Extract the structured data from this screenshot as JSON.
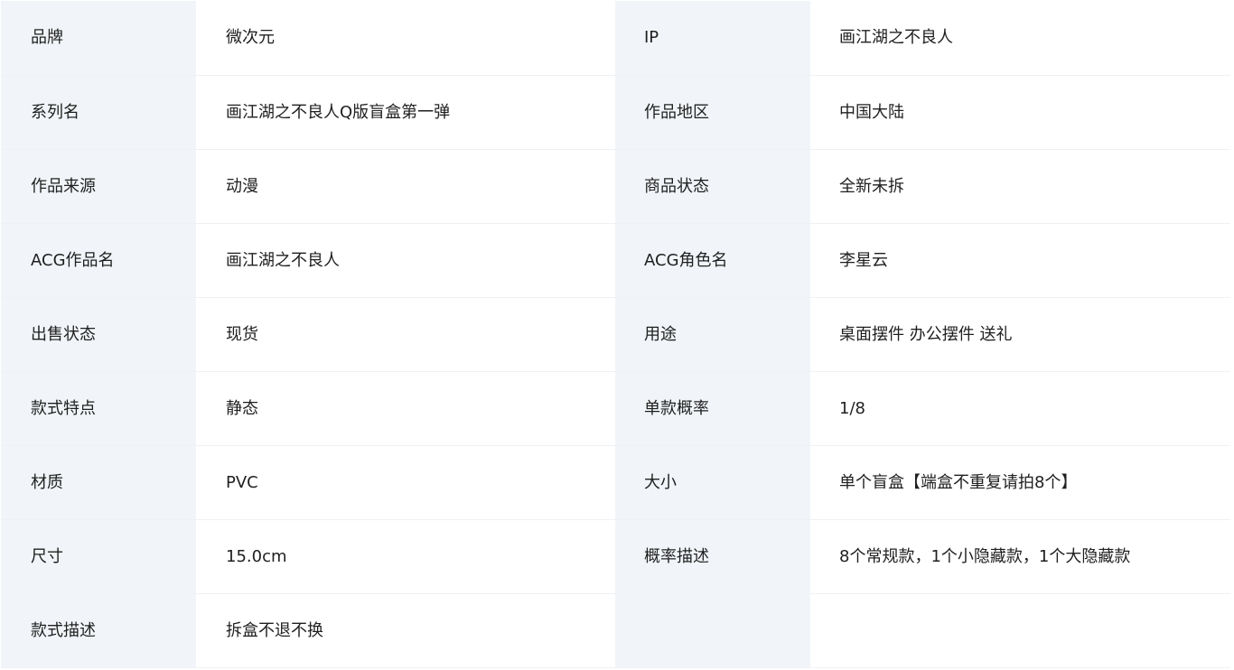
{
  "rows": [
    {
      "left": {
        "label": "品牌",
        "value": "微次元"
      },
      "right": {
        "label": "IP",
        "value": "画江湖之不良人"
      }
    },
    {
      "left": {
        "label": "系列名",
        "value": "画江湖之不良人Q版盲盒第一弹"
      },
      "right": {
        "label": "作品地区",
        "value": "中国大陆"
      }
    },
    {
      "left": {
        "label": "作品来源",
        "value": "动漫"
      },
      "right": {
        "label": "商品状态",
        "value": "全新未拆"
      }
    },
    {
      "left": {
        "label": "ACG作品名",
        "value": "画江湖之不良人"
      },
      "right": {
        "label": "ACG角色名",
        "value": "李星云"
      }
    },
    {
      "left": {
        "label": "出售状态",
        "value": "现货"
      },
      "right": {
        "label": "用途",
        "value": "桌面摆件 办公摆件 送礼"
      }
    },
    {
      "left": {
        "label": "款式特点",
        "value": "静态"
      },
      "right": {
        "label": "单款概率",
        "value": "1/8"
      }
    },
    {
      "left": {
        "label": "材质",
        "value": "PVC"
      },
      "right": {
        "label": "大小",
        "value": "单个盲盒【端盒不重复请拍8个】"
      }
    },
    {
      "left": {
        "label": "尺寸",
        "value": "15.0cm"
      },
      "right": {
        "label": "概率描述",
        "value": "8个常规款，1个小隐藏款，1个大隐藏款"
      }
    },
    {
      "left": {
        "label": "款式描述",
        "value": "拆盒不退不换"
      },
      "right": {
        "label": "",
        "value": ""
      }
    }
  ]
}
